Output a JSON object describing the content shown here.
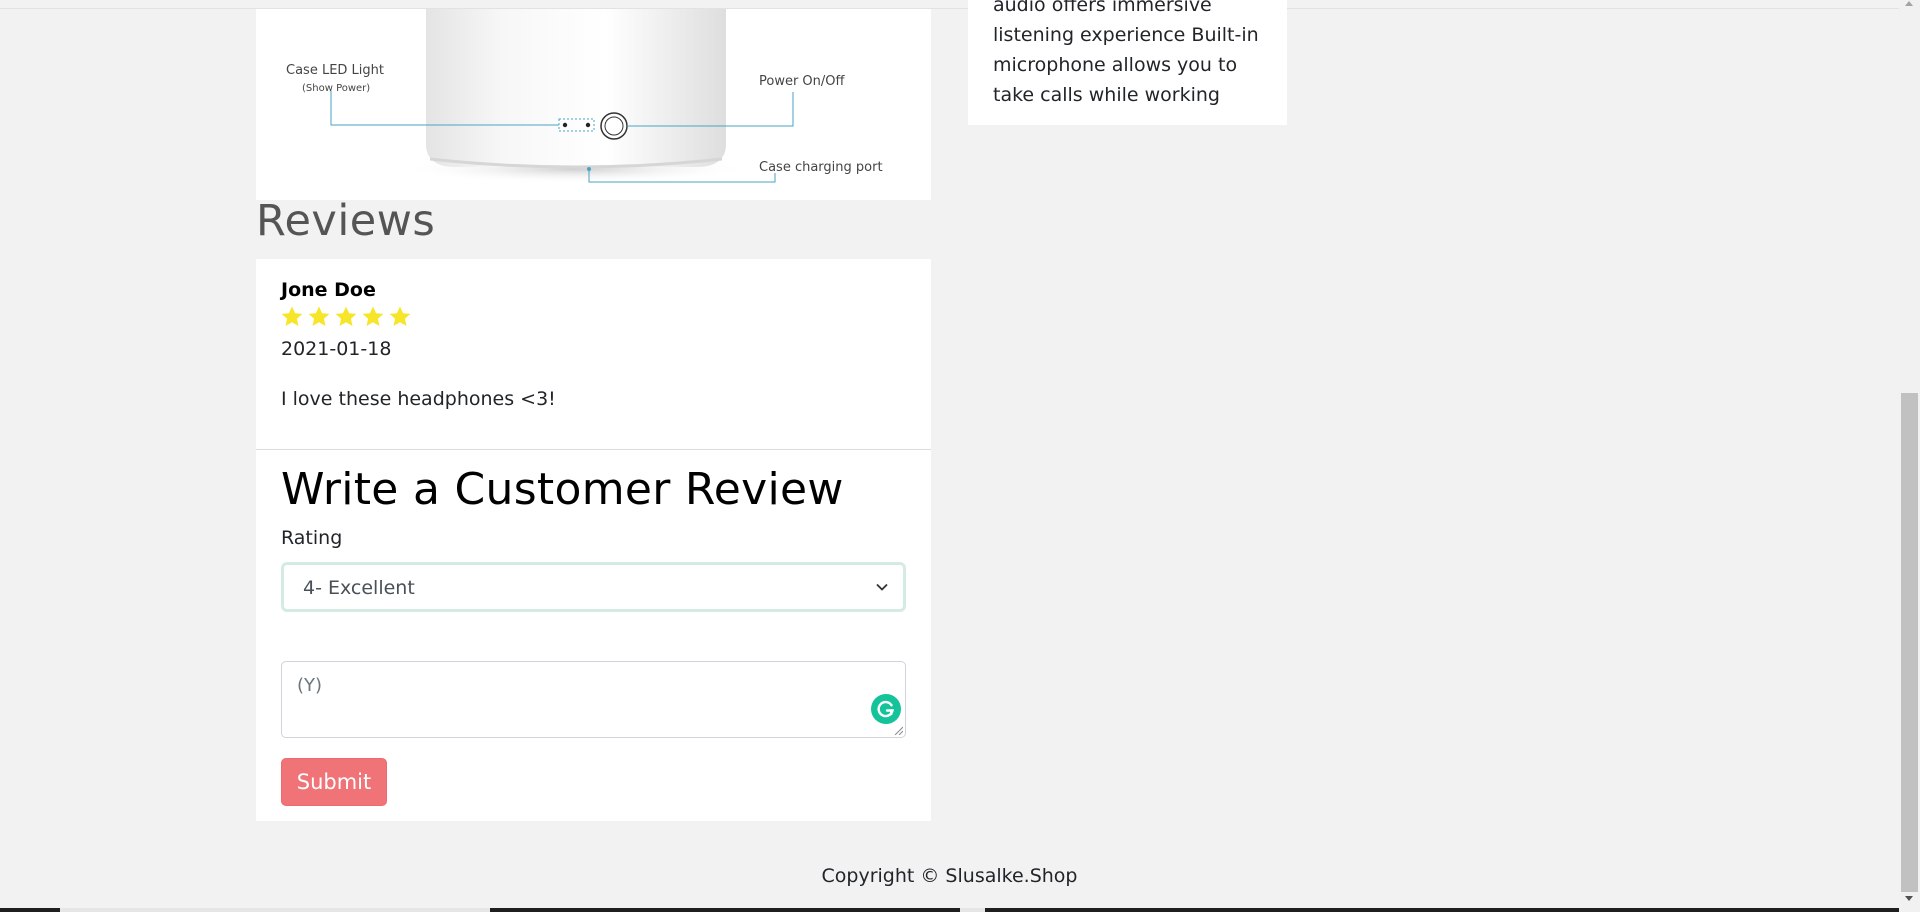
{
  "product_image": {
    "callouts": {
      "case_led_light": "Case LED Light",
      "show_power": "(Show Power)",
      "power_on_off": "Power On/Off",
      "case_charging_port": "Case charging port"
    }
  },
  "description": {
    "text": "audio offers immersive listening experience Built-in microphone allows you to take calls while working"
  },
  "reviews": {
    "heading": "Reviews",
    "items": [
      {
        "author": "Jone Doe",
        "rating": 5,
        "rating_max": 5,
        "date": "2021-01-18",
        "text": "I love these headphones <3!"
      }
    ]
  },
  "review_form": {
    "title": "Write a Customer Review",
    "rating_label": "Rating",
    "rating_selected": "4- Excellent",
    "comment_placeholder": "(Y)",
    "submit_label": "Submit"
  },
  "footer": {
    "copyright": "Copyright © Slusalke.Shop"
  },
  "colors": {
    "page_background": "#f2f2f2",
    "star": "#f7e52a",
    "submit_button": "#f07378",
    "grammarly": "#15c39a",
    "callout_line": "#4aa3c6"
  },
  "icons": {
    "rating_star": "star-icon",
    "select_chevron": "chevron-down-icon",
    "grammarly": "grammarly-icon",
    "resize": "resize-handle-icon",
    "power": "power-icon"
  }
}
